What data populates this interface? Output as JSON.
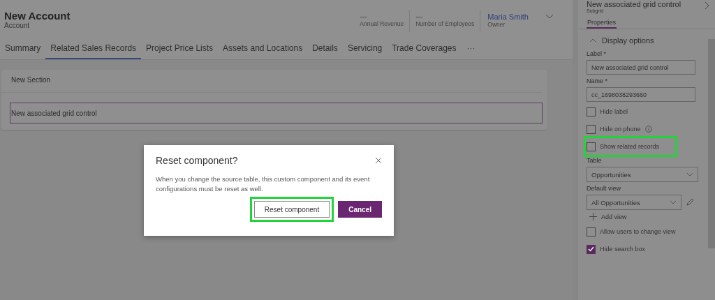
{
  "header": {
    "title": "New Account",
    "subtitle": "Account",
    "fields": [
      {
        "value": "---",
        "label": "Annual Revenue"
      },
      {
        "value": "---",
        "label": "Number of Employees"
      }
    ],
    "owner": {
      "value": "Maria Smith",
      "label": "Owner"
    }
  },
  "tabs": [
    {
      "label": "Summary",
      "selected": false
    },
    {
      "label": "Related Sales Records",
      "selected": true
    },
    {
      "label": "Project Price Lists",
      "selected": false
    },
    {
      "label": "Assets and Locations",
      "selected": false
    },
    {
      "label": "Details",
      "selected": false
    },
    {
      "label": "Servicing",
      "selected": false
    },
    {
      "label": "Trade Coverages",
      "selected": false
    }
  ],
  "tabs_more": "···",
  "section": {
    "title": "New Section",
    "control_label": "New associated grid control"
  },
  "dialog": {
    "title": "Reset component?",
    "body": "When you change the source table, this custom component and its event configurations must be reset as well.",
    "buttons": [
      {
        "label": "Reset component",
        "kind": "secondary",
        "highlighted": true
      },
      {
        "label": "Cancel",
        "kind": "primary",
        "highlighted": false
      }
    ]
  },
  "panel": {
    "title": "New associated grid control",
    "subtitle": "Subgrid",
    "tabs": [
      {
        "label": "Properties",
        "selected": true
      }
    ],
    "group": {
      "title": "Display options",
      "expanded": true
    },
    "items": [
      {
        "kind": "text",
        "label": "Label *",
        "value": "New associated grid control"
      },
      {
        "kind": "text",
        "label": "Name *",
        "value": "cc_1698038293660"
      },
      {
        "kind": "checkbox",
        "label": "Hide label",
        "checked": false,
        "info": false,
        "highlighted": false
      },
      {
        "kind": "checkbox",
        "label": "Hide on phone",
        "checked": false,
        "info": true,
        "highlighted": false
      },
      {
        "kind": "checkbox",
        "label": "Show related records",
        "checked": false,
        "info": false,
        "highlighted": true
      },
      {
        "kind": "dropdown",
        "label": "Table",
        "value": "Opportunities",
        "editable": false
      },
      {
        "kind": "dropdown",
        "label": "Default view",
        "value": "All Opportunities",
        "editable": true
      },
      {
        "kind": "add",
        "label": "Add view"
      },
      {
        "kind": "checkbox",
        "label": "Allow users to change view",
        "checked": false,
        "info": false,
        "highlighted": false
      },
      {
        "kind": "checkbox",
        "label": "Hide search box",
        "checked": true,
        "info": false,
        "highlighted": false
      }
    ]
  }
}
